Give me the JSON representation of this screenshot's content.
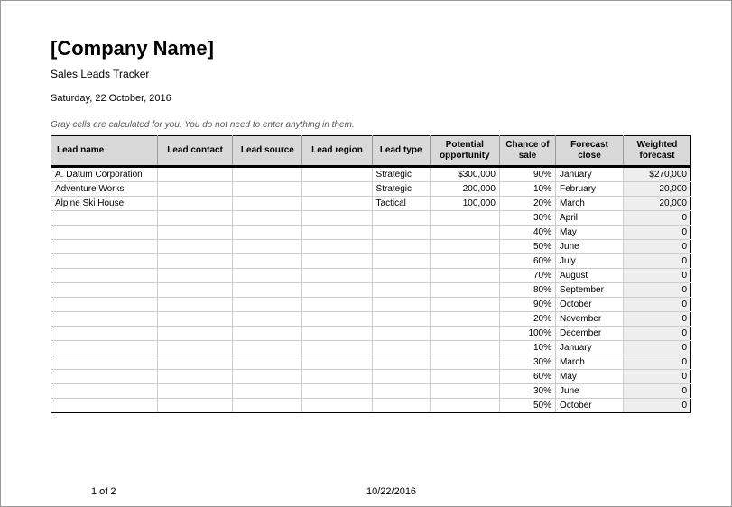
{
  "header": {
    "title": "[Company Name]",
    "subtitle": "Sales Leads Tracker",
    "date": "Saturday, 22 October, 2016",
    "hint": "Gray cells are calculated for you. You do not need to enter anything in them."
  },
  "columns": {
    "lead_name": "Lead   name",
    "lead_contact": "Lead   contact",
    "lead_source": "Lead   source",
    "lead_region": "Lead   region",
    "lead_type": "Lead   type",
    "potential": "Potential opportunity",
    "chance": "Chance of sale",
    "forecast_close": "Forecast close",
    "weighted": "Weighted forecast"
  },
  "rows": [
    {
      "name": "A. Datum Corporation",
      "contact": "",
      "source": "",
      "region": "",
      "type": "Strategic",
      "potential": "$300,000",
      "chance": "90%",
      "close": "January",
      "weighted": "$270,000"
    },
    {
      "name": "Adventure Works",
      "contact": "",
      "source": "",
      "region": "",
      "type": "Strategic",
      "potential": "200,000",
      "chance": "10%",
      "close": "February",
      "weighted": "20,000"
    },
    {
      "name": "Alpine Ski House",
      "contact": "",
      "source": "",
      "region": "",
      "type": "Tactical",
      "potential": "100,000",
      "chance": "20%",
      "close": "March",
      "weighted": "20,000"
    },
    {
      "name": "",
      "contact": "",
      "source": "",
      "region": "",
      "type": "",
      "potential": "",
      "chance": "30%",
      "close": "April",
      "weighted": "0"
    },
    {
      "name": "",
      "contact": "",
      "source": "",
      "region": "",
      "type": "",
      "potential": "",
      "chance": "40%",
      "close": "May",
      "weighted": "0"
    },
    {
      "name": "",
      "contact": "",
      "source": "",
      "region": "",
      "type": "",
      "potential": "",
      "chance": "50%",
      "close": "June",
      "weighted": "0"
    },
    {
      "name": "",
      "contact": "",
      "source": "",
      "region": "",
      "type": "",
      "potential": "",
      "chance": "60%",
      "close": "July",
      "weighted": "0"
    },
    {
      "name": "",
      "contact": "",
      "source": "",
      "region": "",
      "type": "",
      "potential": "",
      "chance": "70%",
      "close": "August",
      "weighted": "0"
    },
    {
      "name": "",
      "contact": "",
      "source": "",
      "region": "",
      "type": "",
      "potential": "",
      "chance": "80%",
      "close": "September",
      "weighted": "0"
    },
    {
      "name": "",
      "contact": "",
      "source": "",
      "region": "",
      "type": "",
      "potential": "",
      "chance": "90%",
      "close": "October",
      "weighted": "0"
    },
    {
      "name": "",
      "contact": "",
      "source": "",
      "region": "",
      "type": "",
      "potential": "",
      "chance": "20%",
      "close": "November",
      "weighted": "0"
    },
    {
      "name": "",
      "contact": "",
      "source": "",
      "region": "",
      "type": "",
      "potential": "",
      "chance": "100%",
      "close": "December",
      "weighted": "0"
    },
    {
      "name": "",
      "contact": "",
      "source": "",
      "region": "",
      "type": "",
      "potential": "",
      "chance": "10%",
      "close": "January",
      "weighted": "0"
    },
    {
      "name": "",
      "contact": "",
      "source": "",
      "region": "",
      "type": "",
      "potential": "",
      "chance": "30%",
      "close": "March",
      "weighted": "0"
    },
    {
      "name": "",
      "contact": "",
      "source": "",
      "region": "",
      "type": "",
      "potential": "",
      "chance": "60%",
      "close": "May",
      "weighted": "0"
    },
    {
      "name": "",
      "contact": "",
      "source": "",
      "region": "",
      "type": "",
      "potential": "",
      "chance": "30%",
      "close": "June",
      "weighted": "0"
    },
    {
      "name": "",
      "contact": "",
      "source": "",
      "region": "",
      "type": "",
      "potential": "",
      "chance": "50%",
      "close": "October",
      "weighted": "0"
    }
  ],
  "footer": {
    "page": "1 of 2",
    "date": "10/22/2016"
  }
}
